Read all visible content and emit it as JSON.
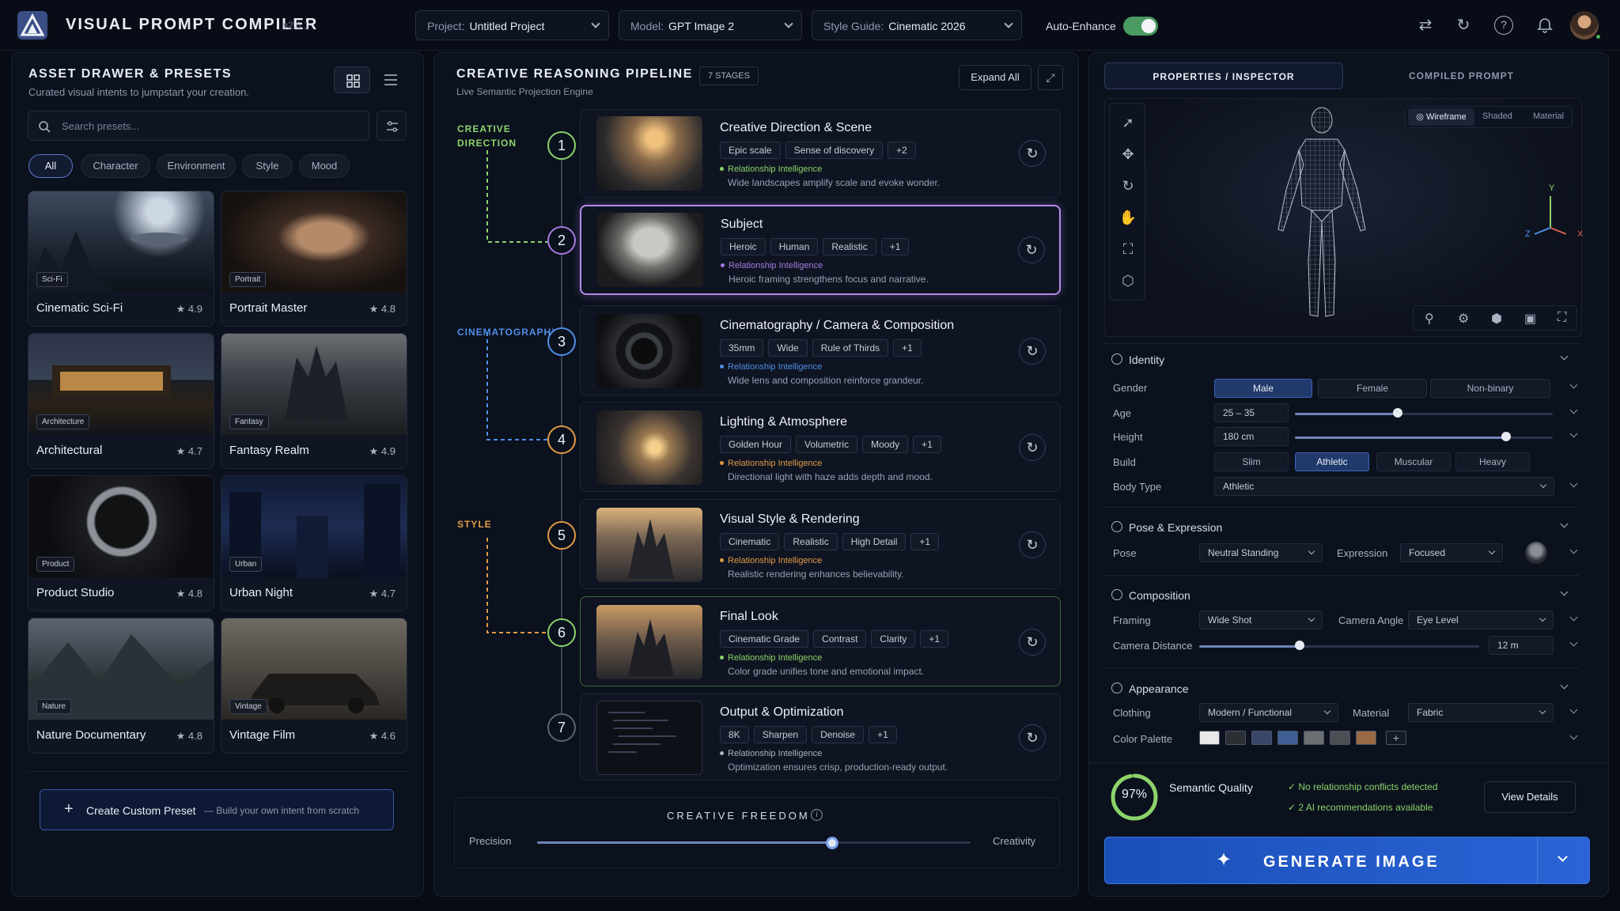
{
  "app": {
    "title": "VISUAL PROMPT COMPILER",
    "version": "v2.6.1"
  },
  "topbar": {
    "project_label": "Project:",
    "project_value": "Untitled Project",
    "model_label": "Model:",
    "model_value": "GPT Image 2",
    "style_label": "Style Guide:",
    "style_value": "Cinematic 2026",
    "auto_enhance_label": "Auto-Enhance",
    "auto_enhance_on": true
  },
  "asset_drawer": {
    "title": "ASSET DRAWER & PRESETS",
    "subtitle": "Curated visual intents to jumpstart your creation.",
    "search_placeholder": "Search presets...",
    "filters": [
      "All",
      "Character",
      "Environment",
      "Style",
      "Mood"
    ],
    "active_filter": "All",
    "presets": [
      {
        "name": "Cinematic Sci-Fi",
        "badge": "Sci-Fi",
        "rating": "★ 4.9"
      },
      {
        "name": "Portrait Master",
        "badge": "Portrait",
        "rating": "★ 4.8"
      },
      {
        "name": "Architectural",
        "badge": "Architecture",
        "rating": "★ 4.7"
      },
      {
        "name": "Fantasy Realm",
        "badge": "Fantasy",
        "rating": "★ 4.9"
      },
      {
        "name": "Product Studio",
        "badge": "Product",
        "rating": "★ 4.8"
      },
      {
        "name": "Urban Night",
        "badge": "Urban",
        "rating": "★ 4.7"
      },
      {
        "name": "Nature Documentary",
        "badge": "Nature",
        "rating": "★ 4.8"
      },
      {
        "name": "Vintage Film",
        "badge": "Vintage",
        "rating": "★ 4.6"
      }
    ],
    "create_label": "Create Custom Preset",
    "create_sub": "— Build your own intent from scratch"
  },
  "pipeline": {
    "title": "CREATIVE REASONING PIPELINE",
    "stages_badge": "7 STAGES",
    "subtitle": "Live Semantic Projection Engine",
    "expand_label": "Expand All",
    "section_labels": {
      "creative": "CREATIVE\nDIRECTION",
      "cinema": "CINEMATOGRAPHY",
      "style": "STYLE"
    },
    "relationship_label": "Relationship Intelligence",
    "stages": [
      {
        "num": "1",
        "title": "Creative Direction & Scene",
        "tags": [
          "Epic scale",
          "Sense of discovery",
          "+2"
        ],
        "desc": "Wide landscapes amplify scale and evoke wonder.",
        "color": "#8cd36a"
      },
      {
        "num": "2",
        "title": "Subject",
        "tags": [
          "Heroic",
          "Human",
          "Realistic",
          "+1"
        ],
        "desc": "Heroic framing strengthens focus and narrative.",
        "color": "#a67be0"
      },
      {
        "num": "3",
        "title": "Cinematography / Camera & Composition",
        "tags": [
          "35mm",
          "Wide",
          "Rule of Thirds",
          "+1"
        ],
        "desc": "Wide lens and composition reinforce grandeur.",
        "color": "#4f8fe8"
      },
      {
        "num": "4",
        "title": "Lighting & Atmosphere",
        "tags": [
          "Golden Hour",
          "Volumetric",
          "Moody",
          "+1"
        ],
        "desc": "Directional light with haze adds depth and mood.",
        "color": "#e09a45"
      },
      {
        "num": "5",
        "title": "Visual Style & Rendering",
        "tags": [
          "Cinematic",
          "Realistic",
          "High Detail",
          "+1"
        ],
        "desc": "Realistic rendering enhances believability.",
        "color": "#e09a45"
      },
      {
        "num": "6",
        "title": "Final Look",
        "tags": [
          "Cinematic Grade",
          "Contrast",
          "Clarity",
          "+1"
        ],
        "desc": "Color grade unifies tone and emotional impact.",
        "color": "#8cd36a"
      },
      {
        "num": "7",
        "title": "Output & Optimization",
        "tags": [
          "8K",
          "Sharpen",
          "Denoise",
          "+1"
        ],
        "desc": "Optimization ensures crisp, production-ready output.",
        "color": "#aab3c2"
      }
    ],
    "freedom": {
      "title": "CREATIVE FREEDOM",
      "left": "Precision",
      "right": "Creativity",
      "value": 0.68
    }
  },
  "inspector": {
    "tabs": [
      "PROPERTIES / INSPECTOR",
      "COMPILED PROMPT"
    ],
    "active_tab": "PROPERTIES / INSPECTOR",
    "view_modes": [
      "Wireframe",
      "Shaded",
      "Material"
    ],
    "active_view": "Wireframe",
    "axes": {
      "x": "X",
      "y": "Y",
      "z": "Z"
    },
    "identity": {
      "title": "Identity",
      "gender_label": "Gender",
      "gender_options": [
        "Male",
        "Female",
        "Non-binary"
      ],
      "gender_value": "Male",
      "age_label": "Age",
      "age_value": "25 – 35",
      "age_level": 0.4,
      "height_label": "Height",
      "height_value": "180 cm",
      "height_level": 0.82,
      "build_label": "Build",
      "build_options": [
        "Slim",
        "Athletic",
        "Muscular",
        "Heavy"
      ],
      "build_value": "Athletic",
      "body_label": "Body Type",
      "body_value": "Athletic"
    },
    "pose": {
      "title": "Pose & Expression",
      "pose_label": "Pose",
      "pose_value": "Neutral Standing",
      "expr_label": "Expression",
      "expr_value": "Focused"
    },
    "composition": {
      "title": "Composition",
      "framing_label": "Framing",
      "framing_value": "Wide Shot",
      "angle_label": "Camera Angle",
      "angle_value": "Eye Level",
      "distance_label": "Camera Distance",
      "distance_value": "12 m",
      "distance_level": 0.36
    },
    "appearance": {
      "title": "Appearance",
      "clothing_label": "Clothing",
      "clothing_value": "Modern / Functional",
      "material_label": "Material",
      "material_value": "Fabric",
      "palette_label": "Color Palette",
      "palette": [
        "#e8e8e8",
        "#2b2e33",
        "#39466a",
        "#3f5f95",
        "#6b6e73",
        "#4b4e52",
        "#9a6a45"
      ],
      "palette_add": "+"
    }
  },
  "quality": {
    "score": "97%",
    "score_level": 0.97,
    "label": "Semantic Quality",
    "check1": "No relationship conflicts detected",
    "check2": "2 AI recommendations available",
    "details": "View Details"
  },
  "generate": {
    "label": "GENERATE IMAGE"
  }
}
